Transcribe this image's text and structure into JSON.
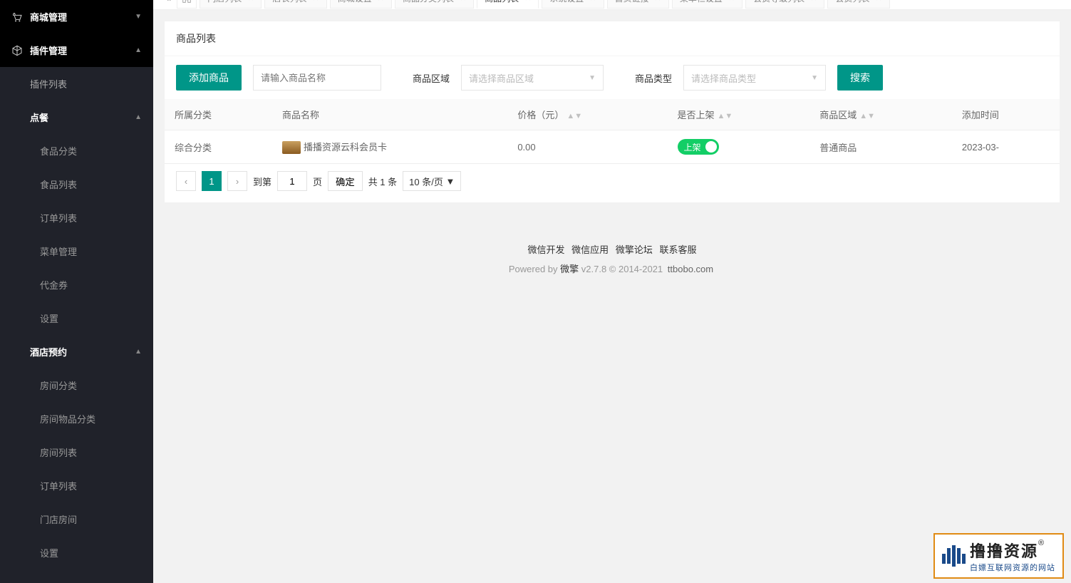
{
  "sidebar": {
    "mall_mgmt": "商城管理",
    "plugin_mgmt": "插件管理",
    "plugin_list": "插件列表",
    "ordering": "点餐",
    "food_cat": "食品分类",
    "food_list": "食品列表",
    "order_list": "订单列表",
    "menu_mgmt": "菜单管理",
    "voucher": "代金券",
    "settings": "设置",
    "hotel": "酒店预约",
    "room_cat": "房间分类",
    "room_item_cat": "房间物品分类",
    "room_list": "房间列表",
    "hotel_order": "订单列表",
    "store_room": "门店房间",
    "hotel_settings": "设置"
  },
  "tabs": [
    {
      "label": "门店列表"
    },
    {
      "label": "店长列表"
    },
    {
      "label": "商城设置"
    },
    {
      "label": "商品分类列表"
    },
    {
      "label": "商品列表",
      "active": true
    },
    {
      "label": "系统设置"
    },
    {
      "label": "首页链接"
    },
    {
      "label": "菜单栏设置"
    },
    {
      "label": "会员等级列表"
    },
    {
      "label": "会员列表"
    }
  ],
  "panel": {
    "title": "商品列表"
  },
  "toolbar": {
    "add_btn": "添加商品",
    "name_placeholder": "请输入商品名称",
    "region_label": "商品区域",
    "region_placeholder": "请选择商品区域",
    "type_label": "商品类型",
    "type_placeholder": "请选择商品类型",
    "search_btn": "搜索"
  },
  "table": {
    "headers": {
      "category": "所属分类",
      "name": "商品名称",
      "price": "价格（元）",
      "on_shelf": "是否上架",
      "region": "商品区域",
      "add_time": "添加时间"
    },
    "row": {
      "category": "综合分类",
      "name": "播播资源云科会员卡",
      "price": "0.00",
      "on_shelf": "上架",
      "region": "普通商品",
      "add_time": "2023-03-"
    }
  },
  "pagination": {
    "goto_label": "到第",
    "page_val": "1",
    "page_label": "页",
    "confirm": "确定",
    "total": "共 1 条",
    "per_page": "10 条/页"
  },
  "footer": {
    "links": [
      "微信开发",
      "微信应用",
      "微擎论坛",
      "联系客服"
    ],
    "powered": "Powered by",
    "brand": "微擎",
    "version": "v2.7.8 © 2014-2021",
    "site": "ttbobo.com"
  },
  "watermark": {
    "title": "撸撸资源",
    "reg": "®",
    "sub": "白嫖互联网资源的网站"
  }
}
